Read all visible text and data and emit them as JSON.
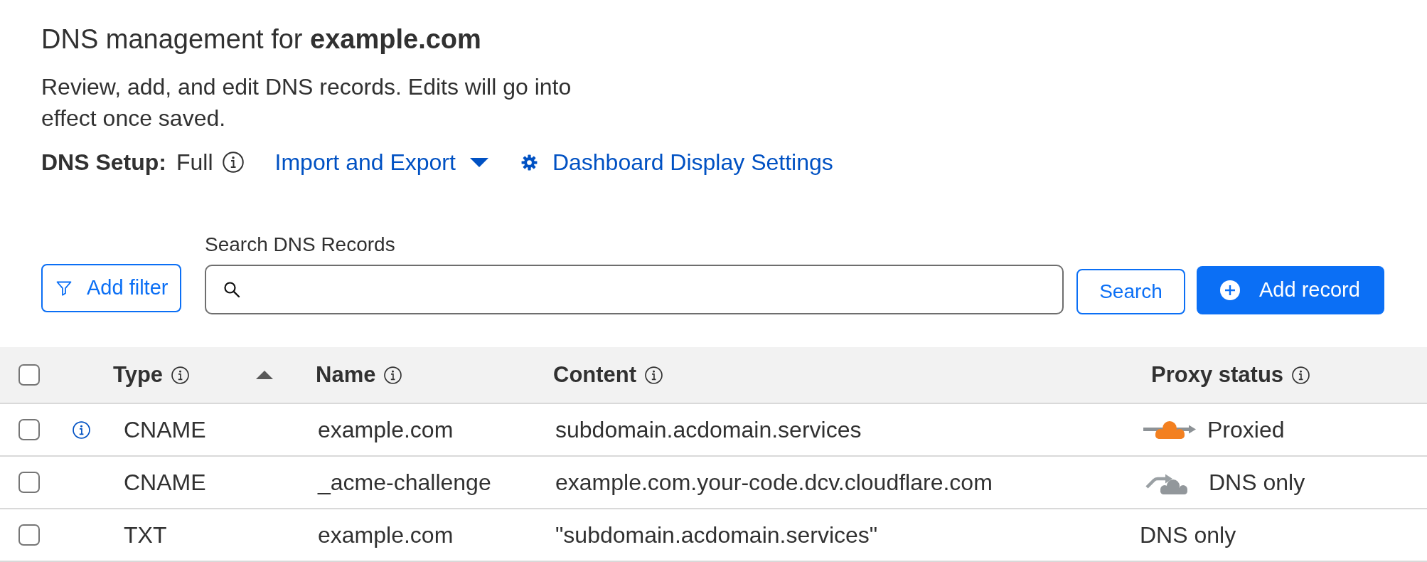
{
  "page": {
    "title": "DNS management for **example.com**",
    "description": "Review, add, and edit DNS records. Edits will go into effect once saved."
  },
  "dns_setup": {
    "label": "DNS Setup:",
    "value": "Full",
    "info": true
  },
  "links": [
    {
      "kind": "dropdown",
      "label": "Import and Export"
    },
    {
      "kind": "settings",
      "label": "Dashboard Display Settings"
    }
  ],
  "toolbar": {
    "filter_button": "Add filter",
    "search": {
      "label": "Search DNS Records"
    },
    "search_button": "Search",
    "add_button": "Add record"
  },
  "table": {
    "select_all": {
      "checked": false
    },
    "columns": [
      {
        "label": "Type",
        "info": true,
        "sorted": true
      },
      {
        "label": "Name",
        "info": true,
        "sorted": false
      },
      {
        "label": "Content",
        "info": true,
        "sorted": false
      },
      {
        "label": "Proxy status",
        "info": true,
        "sorted": false
      }
    ],
    "rows": [
      {
        "selected": false,
        "info": true,
        "type": "CNAME",
        "name": "example.com",
        "content": "subdomain.acdomain.services",
        "proxy": {
          "kind": "proxied",
          "label": "Proxied"
        }
      },
      {
        "selected": false,
        "info": false,
        "type": "CNAME",
        "name": "_acme-challenge",
        "content": "example.com.your-code.dcv.cloudflare.com",
        "proxy": {
          "kind": "dnsonly",
          "label": "DNS only"
        }
      },
      {
        "selected": false,
        "info": false,
        "type": "TXT",
        "name": "example.com",
        "content": "\"subdomain.acdomain.services\"",
        "proxy": {
          "kind": "plain",
          "label": "DNS only"
        }
      }
    ]
  }
}
